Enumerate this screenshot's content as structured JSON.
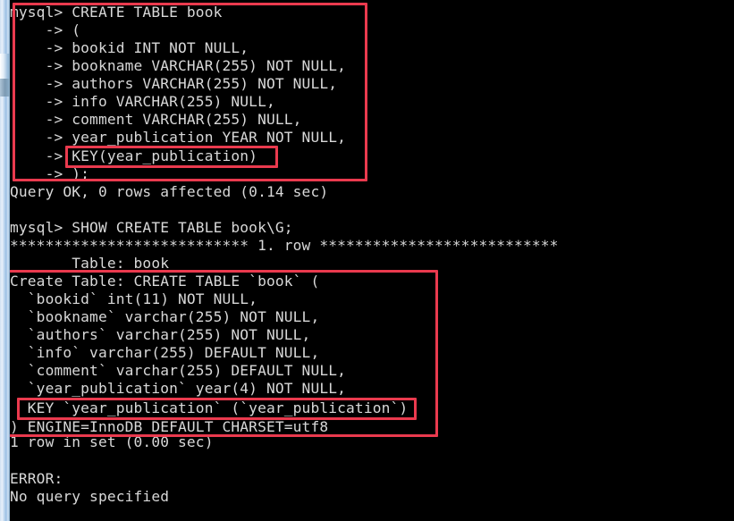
{
  "terminal": {
    "title": "mysql command line client",
    "text_color": "#d8d8d8",
    "background_color": "#000000",
    "highlight_color": "#ea3a4e",
    "lines": [
      {
        "id": "l01",
        "text": "mysql> CREATE TABLE book"
      },
      {
        "id": "l02",
        "text": "    -> ("
      },
      {
        "id": "l03",
        "text": "    -> bookid INT NOT NULL,"
      },
      {
        "id": "l04",
        "text": "    -> bookname VARCHAR(255) NOT NULL,"
      },
      {
        "id": "l05",
        "text": "    -> authors VARCHAR(255) NOT NULL,"
      },
      {
        "id": "l06",
        "text": "    -> info VARCHAR(255) NULL,"
      },
      {
        "id": "l07",
        "text": "    -> comment VARCHAR(255) NULL,"
      },
      {
        "id": "l08",
        "text": "    -> year_publication YEAR NOT NULL,"
      },
      {
        "id": "l09",
        "text": "    -> KEY(year_publication)"
      },
      {
        "id": "l10",
        "text": "    -> );"
      },
      {
        "id": "l11",
        "text": "Query OK, 0 rows affected (0.14 sec)"
      },
      {
        "id": "l12",
        "text": ""
      },
      {
        "id": "l13",
        "text": "mysql> SHOW CREATE TABLE book\\G;"
      },
      {
        "id": "l14",
        "text": "*************************** 1. row ***************************"
      },
      {
        "id": "l15",
        "text": "       Table: book"
      },
      {
        "id": "l16",
        "text": "Create Table: CREATE TABLE `book` ("
      },
      {
        "id": "l17",
        "text": "  `bookid` int(11) NOT NULL,"
      },
      {
        "id": "l18",
        "text": "  `bookname` varchar(255) NOT NULL,"
      },
      {
        "id": "l19",
        "text": "  `authors` varchar(255) NOT NULL,"
      },
      {
        "id": "l20",
        "text": "  `info` varchar(255) DEFAULT NULL,"
      },
      {
        "id": "l21",
        "text": "  `comment` varchar(255) DEFAULT NULL,"
      },
      {
        "id": "l22",
        "text": "  `year_publication` year(4) NOT NULL,"
      },
      {
        "id": "l23",
        "text": "  KEY `year_publication` (`year_publication`)"
      },
      {
        "id": "l24",
        "text": ") ENGINE=InnoDB DEFAULT CHARSET=utf8"
      },
      {
        "id": "l25",
        "text": "1 row in set (0.00 sec)"
      },
      {
        "id": "l26",
        "text": ""
      },
      {
        "id": "l27",
        "text": "ERROR:"
      },
      {
        "id": "l28",
        "text": "No query specified"
      }
    ],
    "annotations": [
      {
        "id": "a1",
        "name": "create-table-statement-box"
      },
      {
        "id": "a2",
        "name": "key-clause-box"
      },
      {
        "id": "a3",
        "name": "show-create-table-output-box"
      },
      {
        "id": "a4",
        "name": "key-index-definition-box"
      }
    ]
  }
}
